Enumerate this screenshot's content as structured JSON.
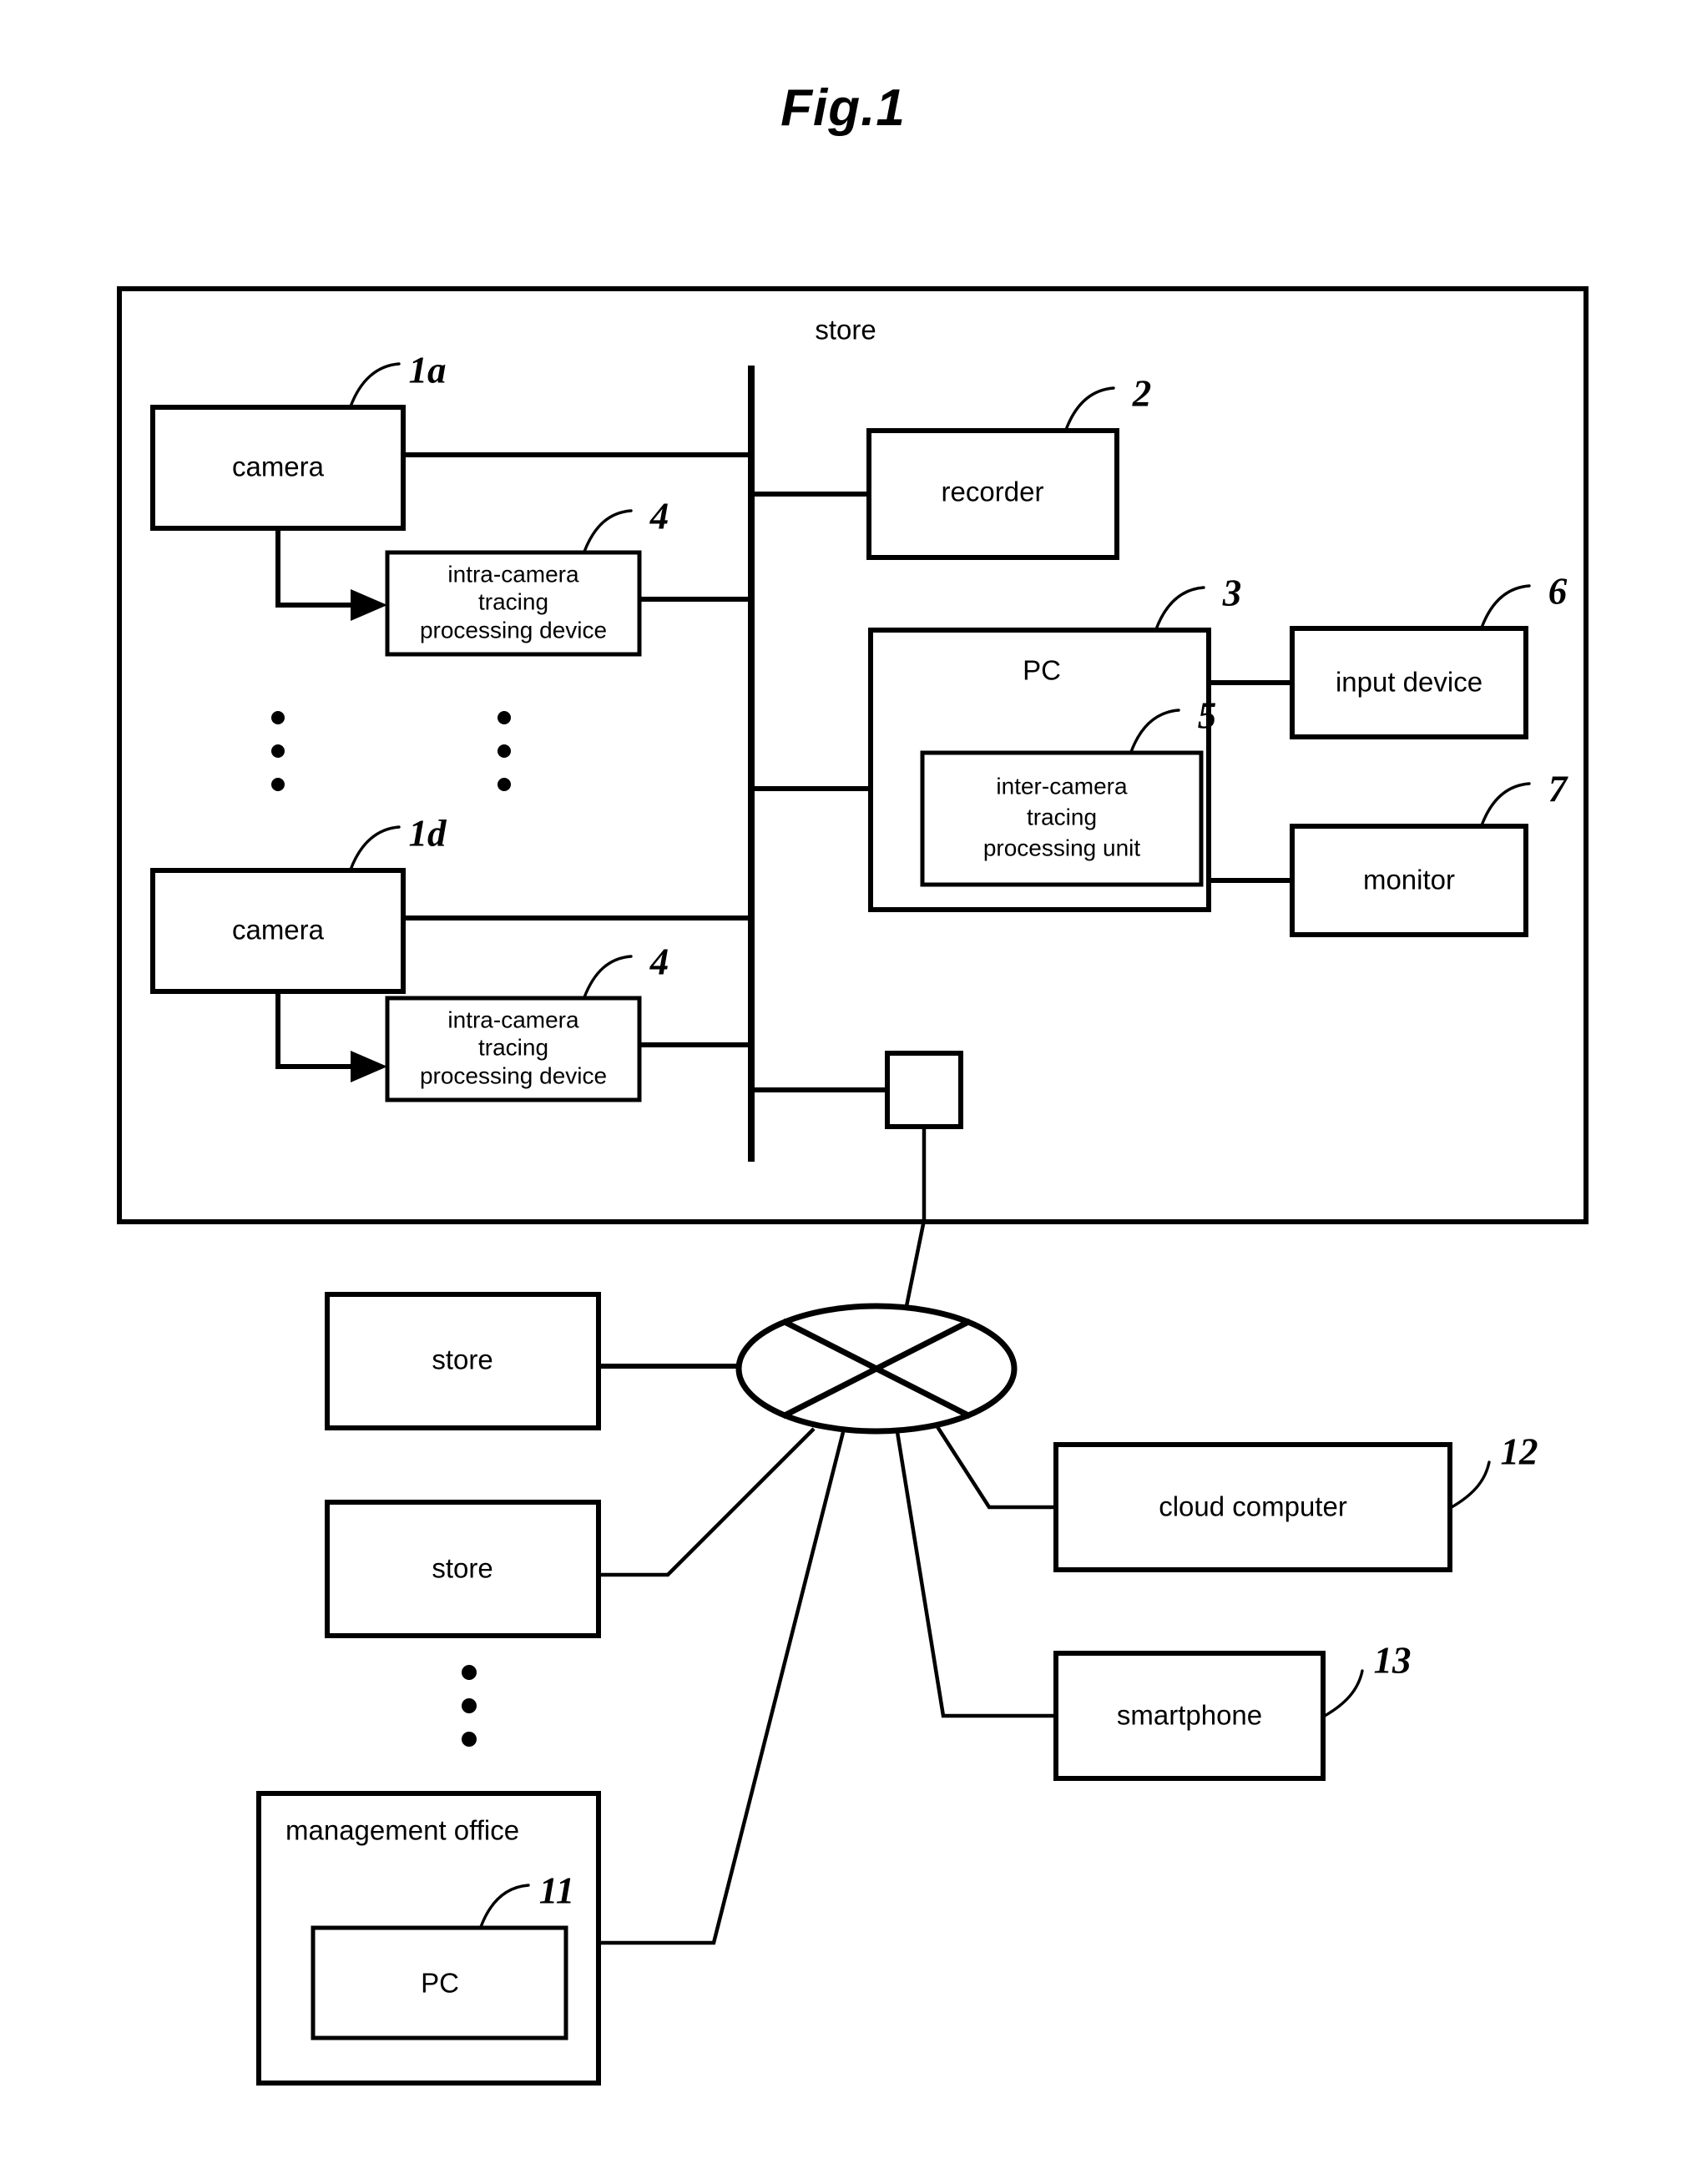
{
  "figure": {
    "title": "Fig.1",
    "type": "patent-block-diagram"
  },
  "store_enclosure": {
    "label": "store",
    "reference": ""
  },
  "blocks": {
    "camera_top": {
      "label": "camera",
      "reference": "1a"
    },
    "camera_bottom": {
      "label": "camera",
      "reference": "1d"
    },
    "intra_camera_top": {
      "label_line1": "intra-camera",
      "label_line2": "tracing",
      "label_line3": "processing  device",
      "reference": "4"
    },
    "intra_camera_bottom": {
      "label_line1": "intra-camera",
      "label_line2": "tracing",
      "label_line3": "processing  device",
      "reference": "4"
    },
    "recorder": {
      "label": "recorder",
      "reference": "2"
    },
    "pc_store": {
      "label": "PC",
      "reference": "3"
    },
    "inter_camera_unit": {
      "label_line1": "inter-camera",
      "label_line2": "tracing",
      "label_line3": "processing  unit",
      "reference": "5"
    },
    "input_device": {
      "label": "input  device",
      "reference": "6"
    },
    "monitor": {
      "label": "monitor",
      "reference": "7"
    },
    "gateway": {
      "label": "",
      "reference": ""
    },
    "store_remote_1": {
      "label": "store",
      "reference": ""
    },
    "store_remote_2": {
      "label": "store",
      "reference": ""
    },
    "management_office": {
      "label": "management  office",
      "reference": ""
    },
    "pc_office": {
      "label": "PC",
      "reference": "11"
    },
    "cloud_computer": {
      "label": "cloud  computer",
      "reference": "12"
    },
    "smartphone": {
      "label": "smartphone",
      "reference": "13"
    },
    "network_node": {
      "label": "",
      "reference": ""
    }
  },
  "ellipsis": {
    "camera_column": "⋮",
    "intra_column": "⋮",
    "store_column": "⋮"
  },
  "colors": {
    "stroke": "#000000",
    "background": "#ffffff"
  }
}
